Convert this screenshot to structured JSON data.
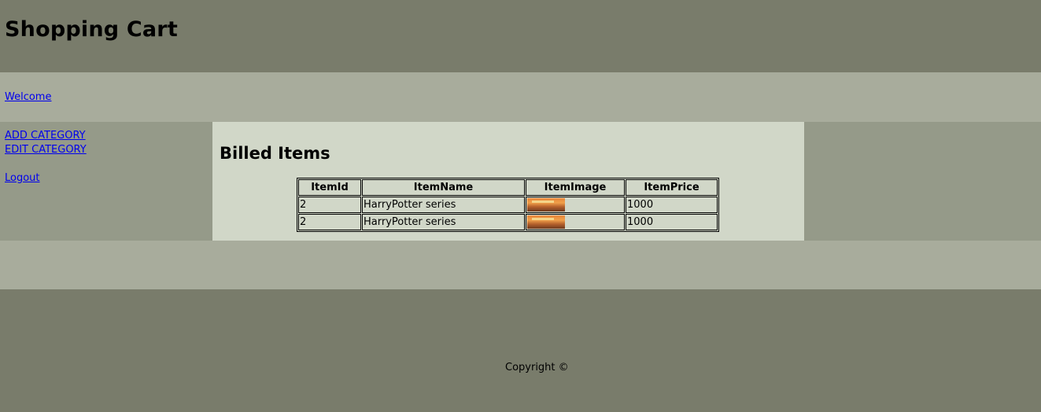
{
  "header": {
    "title": "Shopping Cart"
  },
  "welcome": {
    "link": "Welcome"
  },
  "sidebar": {
    "items": [
      {
        "label": "ADD CATEGORY"
      },
      {
        "label": "EDIT CATEGORY"
      },
      {
        "label": "Logout"
      }
    ]
  },
  "main": {
    "heading": "Billed Items",
    "table": {
      "headers": [
        "ItemId",
        "ItemName",
        "ItemImage",
        "ItemPrice"
      ],
      "rows": [
        {
          "id": "2",
          "name": "HarryPotter series",
          "image": "book-cover-thumbnail",
          "price": "1000"
        },
        {
          "id": "2",
          "name": "HarryPotter series",
          "image": "book-cover-thumbnail",
          "price": "1000"
        }
      ]
    }
  },
  "footer": {
    "copyright": "Copyright ©"
  },
  "colors": {
    "header_bg": "#797c6b",
    "band_bg": "#a8ac9c",
    "sidebar_bg": "#959a89",
    "main_bg": "#d1d7c8",
    "link": "#0000ee"
  }
}
